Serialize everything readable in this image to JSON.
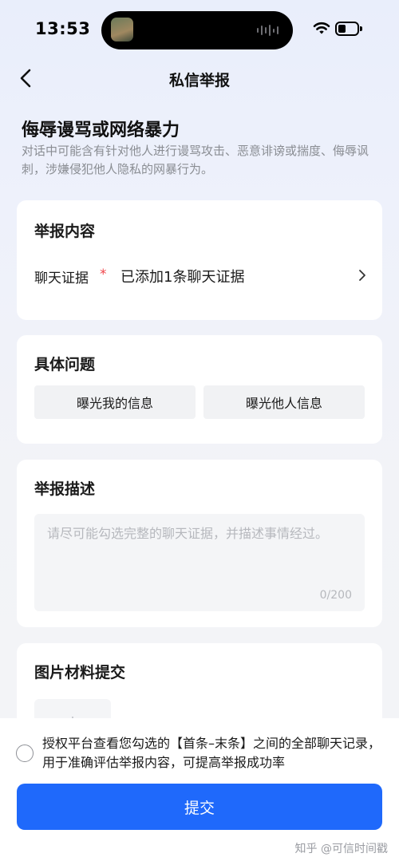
{
  "status_bar": {
    "time": "13:53"
  },
  "nav": {
    "title": "私信举报",
    "back_icon": "chevron-left-icon"
  },
  "category": {
    "title": "侮辱谩骂或网络暴力",
    "description": "对话中可能含有针对他人进行谩骂攻击、恶意诽谤或揣度、侮辱讽刺，涉嫌侵犯他人隐私的网暴行为。"
  },
  "report_content": {
    "title": "举报内容",
    "evidence_label": "聊天证据",
    "required_mark": "*",
    "evidence_value": "已添加1条聊天证据"
  },
  "specific_issue": {
    "title": "具体问题",
    "options": [
      "曝光我的信息",
      "曝光他人信息"
    ]
  },
  "description": {
    "title": "举报描述",
    "placeholder": "请尽可能勾选完整的聊天证据，并描述事情经过。",
    "counter": "0/200"
  },
  "images": {
    "title": "图片材料提交"
  },
  "consent": {
    "text": "授权平台查看您勾选的【首条–末条】之间的全部聊天记录，用于准确评估举报内容，可提高举报成功率"
  },
  "submit_label": "提交",
  "watermark": "知乎 @可信时间戳",
  "colors": {
    "primary": "#1f69fb",
    "required": "#f0454a",
    "muted": "#8a8d93"
  }
}
